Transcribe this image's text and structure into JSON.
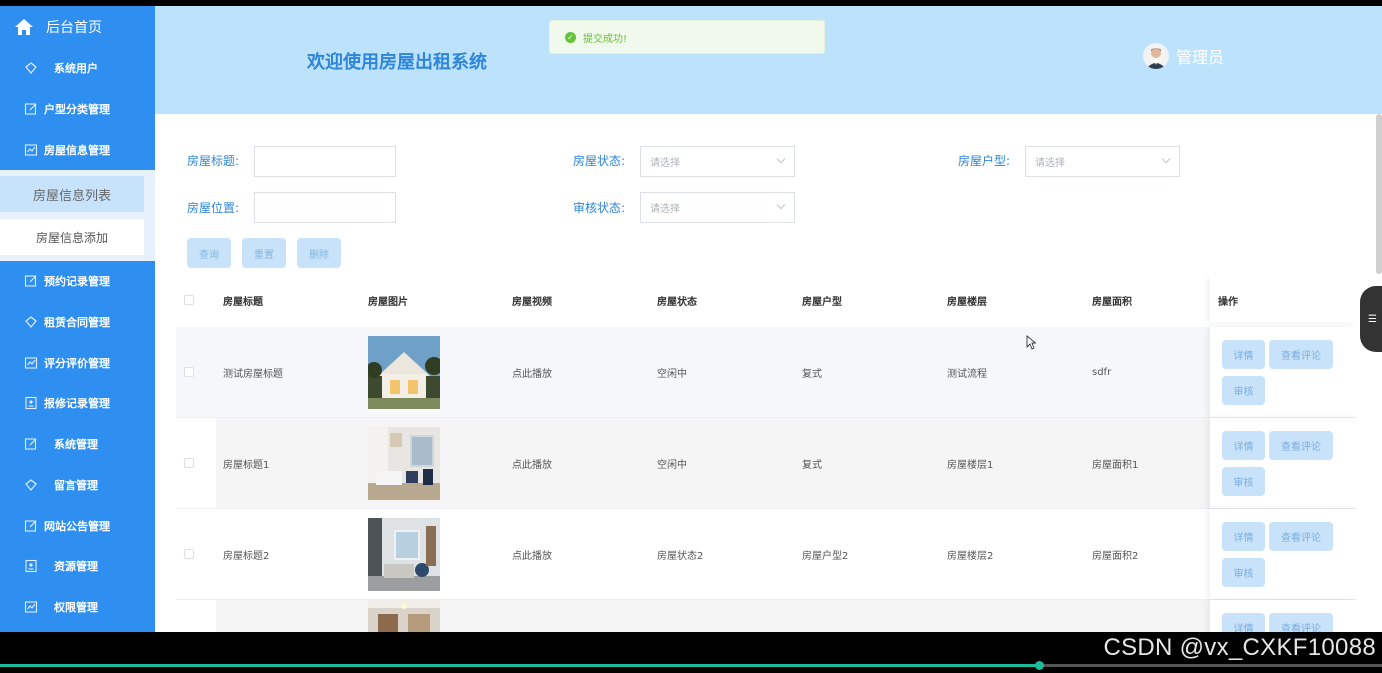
{
  "sidebar": {
    "home": {
      "label": "后台首页",
      "icon": "home-icon"
    },
    "items": [
      {
        "label": "系统用户",
        "icon": "diamond-icon",
        "center": true
      },
      {
        "label": "户型分类管理",
        "icon": "edit-icon"
      },
      {
        "label": "房屋信息管理",
        "icon": "chart-icon"
      }
    ],
    "sub_items": [
      {
        "label": "房屋信息列表",
        "active": true
      },
      {
        "label": "房屋信息添加",
        "active": false
      }
    ],
    "items_after": [
      {
        "label": "预约记录管理",
        "icon": "edit-icon"
      },
      {
        "label": "租赁合同管理",
        "icon": "diamond-icon"
      },
      {
        "label": "评分评价管理",
        "icon": "chart-icon"
      },
      {
        "label": "报修记录管理",
        "icon": "doc-icon"
      },
      {
        "label": "系统管理",
        "icon": "edit-icon",
        "center": true
      },
      {
        "label": "留言管理",
        "icon": "diamond-icon",
        "center": true
      },
      {
        "label": "网站公告管理",
        "icon": "edit-icon"
      },
      {
        "label": "资源管理",
        "icon": "doc-icon",
        "center": true
      },
      {
        "label": "权限管理",
        "icon": "chart-icon",
        "center": true
      }
    ]
  },
  "header": {
    "title": "欢迎使用房屋出租系统",
    "user_name": "管理员"
  },
  "toast": {
    "message": "提交成功!"
  },
  "search": {
    "title_label": "房屋标题:",
    "title_value": "",
    "status_label": "房屋状态:",
    "status_placeholder": "请选择",
    "type_label": "房屋户型:",
    "type_placeholder": "请选择",
    "location_label": "房屋位置:",
    "location_value": "",
    "audit_label": "审核状态:",
    "audit_placeholder": "请选择",
    "query_button": "查询",
    "reset_button": "重置",
    "delete_button": "删除"
  },
  "table": {
    "columns": [
      "房屋标题",
      "房屋图片",
      "房屋视频",
      "房屋状态",
      "房屋户型",
      "房屋楼层",
      "房屋面积",
      "操作"
    ],
    "rows": [
      {
        "title": "测试房屋标题",
        "video": "点此播放",
        "status": "空闲中",
        "type": "复式",
        "floor": "测试流程",
        "area": "sdfr"
      },
      {
        "title": "房屋标题1",
        "video": "点此播放",
        "status": "空闲中",
        "type": "复式",
        "floor": "房屋楼层1",
        "area": "房屋面积1"
      },
      {
        "title": "房屋标题2",
        "video": "点此播放",
        "status": "房屋状态2",
        "type": "房屋户型2",
        "floor": "房屋楼层2",
        "area": "房屋面积2"
      },
      {
        "title": "",
        "video": "",
        "status": "",
        "type": "",
        "floor": "",
        "area": ""
      }
    ],
    "op_detail": "详情",
    "op_comments": "查看评论",
    "op_audit": "审核"
  },
  "footer": {
    "watermark": "CSDN @vx_CXKF10088",
    "video_progress": 0.752
  },
  "colors": {
    "sidebar_bg": "#2e8ff0",
    "header_bg": "#bde2fc",
    "accent_text": "#2f86d8",
    "button_light": "#c8e3f9",
    "success": "#67c23a"
  }
}
